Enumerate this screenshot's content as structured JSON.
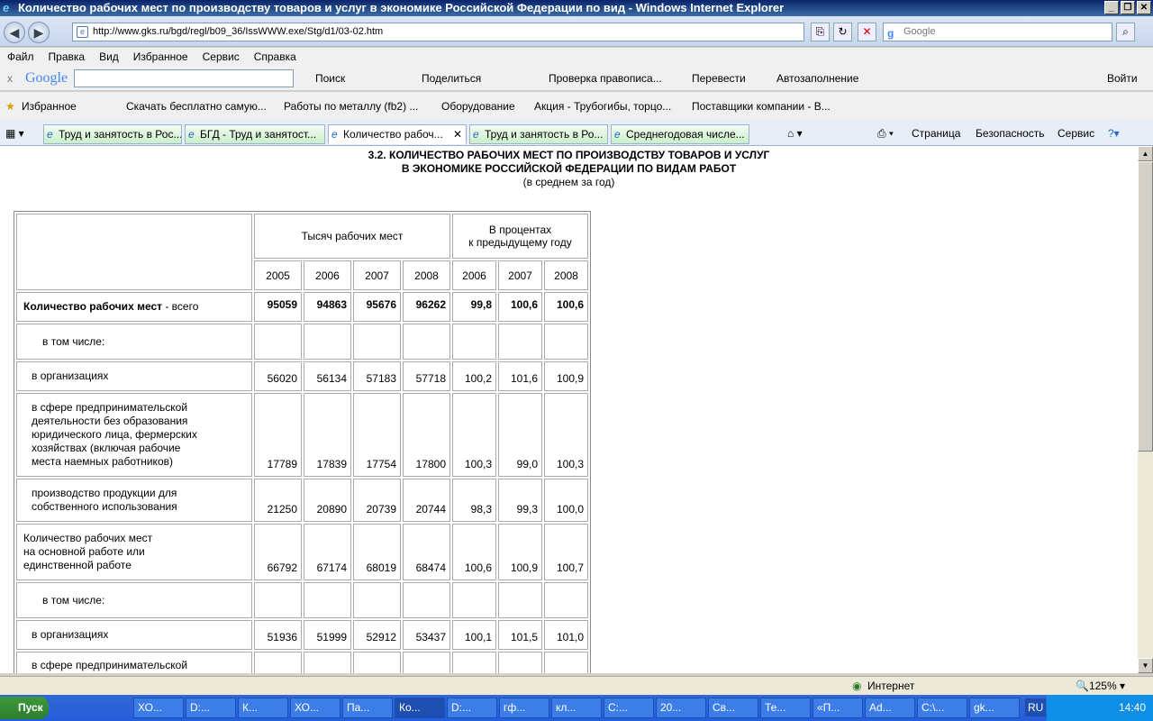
{
  "window": {
    "title": "Количество рабочих мест по производству товаров и услуг в экономике Российской Федерации по вид - Windows Internet Explorer"
  },
  "address": {
    "url": "http://www.gks.ru/bgd/regl/b09_36/IssWWW.exe/Stg/d1/03-02.htm",
    "search_placeholder": "Google"
  },
  "menu": [
    "Файл",
    "Правка",
    "Вид",
    "Избранное",
    "Сервис",
    "Справка"
  ],
  "google_toolbar": {
    "logo": "Google",
    "search": "Поиск",
    "share": "Поделиться",
    "spell": "Проверка правописа...",
    "translate": "Перевести",
    "autofill": "Автозаполнение",
    "login": "Войти"
  },
  "favorites": {
    "label": "Избранное",
    "items": [
      "Скачать бесплатно самую...",
      "Работы по металлу (fb2) ...",
      "Оборудование",
      "Акция - Трубогибы, торцо...",
      "Поставщики компании - В..."
    ]
  },
  "tabs": [
    "Труд и занятость в Рос...",
    "БГД - Труд и занятост...",
    "Количество рабоч...",
    "Труд и занятость в Ро...",
    "Среднегодовая числе..."
  ],
  "tools": {
    "page": "Страница",
    "security": "Безопасность",
    "service": "Сервис"
  },
  "page": {
    "title1": "3.2. КОЛИЧЕСТВО РАБОЧИХ МЕСТ ПО ПРОИЗВОДСТВУ ТОВАРОВ И УСЛУГ",
    "title2": "В ЭКОНОМИКЕ РОССИЙСКОЙ ФЕДЕРАЦИИ ПО ВИДАМ РАБОТ",
    "subtitle": "(в среднем за год)",
    "header_thousand": "Тысяч рабочих мест",
    "header_percent1": "В процентах",
    "header_percent2": "к предыдущему году",
    "years": [
      "2005",
      "2006",
      "2007",
      "2008",
      "2006",
      "2007",
      "2008"
    ],
    "rows": [
      {
        "b": "Количество рабочих мест",
        "l": " - всего",
        "v": [
          "95059",
          "94863",
          "95676",
          "96262",
          "99,8",
          "100,6",
          "100,6"
        ]
      },
      {
        "l": "в том числе:",
        "v": [
          "",
          "",
          "",
          "",
          "",
          "",
          ""
        ]
      },
      {
        "l": "в организациях",
        "v": [
          "56020",
          "56134",
          "57183",
          "57718",
          "100,2",
          "101,6",
          "100,9"
        ]
      },
      {
        "l": "в сфере предпринимательской\nдеятельности без образования\nюридического лица, фермерских\nхозяйствах (включая рабочие\nместа наемных работников)",
        "v": [
          "17789",
          "17839",
          "17754",
          "17800",
          "100,3",
          "99,0",
          "100,3"
        ]
      },
      {
        "l": "производство продукции для\nсобственного использования",
        "v": [
          "21250",
          "20890",
          "20739",
          "20744",
          "98,3",
          "99,3",
          "100,0"
        ]
      },
      {
        "l": "Количество рабочих мест\nна основной работе или\nединственной работе",
        "v": [
          "66792",
          "67174",
          "68019",
          "68474",
          "100,6",
          "100,9",
          "100,7"
        ]
      },
      {
        "l": "в том числе:",
        "v": [
          "",
          "",
          "",
          "",
          "",
          "",
          ""
        ]
      },
      {
        "l": "в организациях",
        "v": [
          "51936",
          "51999",
          "52912",
          "53437",
          "100,1",
          "101,5",
          "101,0"
        ]
      },
      {
        "l": "в сфере предпринимательской",
        "v": [
          "",
          "",
          "",
          "",
          "",
          "",
          ""
        ]
      }
    ]
  },
  "status": {
    "zone": "Интернет",
    "zoom": "125%"
  },
  "taskbar": {
    "start": "Пуск",
    "items": [
      "ХО...",
      "D:...",
      "К...",
      "ХО...",
      "Па...",
      "Ко...",
      "D:...",
      "гф...",
      "кл...",
      "C:...",
      "20...",
      "Св...",
      "Те...",
      "«П...",
      "Ad...",
      "C:\\...",
      "gk..."
    ],
    "lang": "RU",
    "clock": "14:40"
  }
}
